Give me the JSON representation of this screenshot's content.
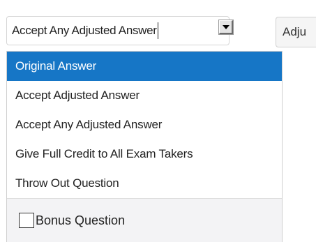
{
  "select": {
    "current_value": "Accept Any Adjusted Answer",
    "arrow_icon": "chevron-down-icon"
  },
  "side_tab": {
    "label": "Adju"
  },
  "dropdown": {
    "options": [
      {
        "label": "Original Answer",
        "selected": true
      },
      {
        "label": "Accept Adjusted Answer",
        "selected": false
      },
      {
        "label": "Accept Any Adjusted Answer",
        "selected": false
      },
      {
        "label": "Give Full Credit to All Exam Takers",
        "selected": false
      },
      {
        "label": "Throw Out Question",
        "selected": false
      }
    ],
    "bonus": {
      "label": "Bonus Question",
      "checked": false
    }
  },
  "colors": {
    "selected_background": "#1676c6",
    "selected_text": "#ffffff",
    "bonus_background": "#f3f3f5"
  }
}
